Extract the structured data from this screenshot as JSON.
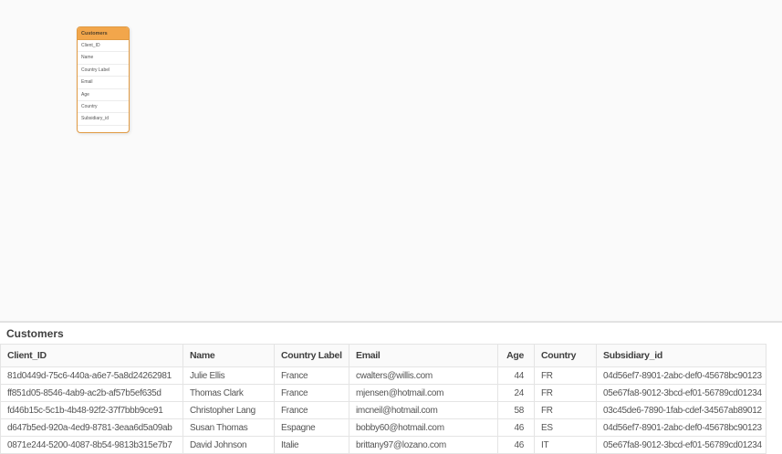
{
  "colors": {
    "card_header_orange": "#f2a64b",
    "card_border_orange": "#e09a43",
    "canvas_background": "#fafafa",
    "table_border_gray": "#e4e4e4"
  },
  "canvas": {
    "card": {
      "title": "Customers",
      "fields": [
        "Client_ID",
        "Name",
        "Country Label",
        "Email",
        "Age",
        "Country",
        "Subsidiary_id"
      ]
    }
  },
  "preview": {
    "title": "Customers",
    "table": {
      "columns": [
        "Client_ID",
        "Name",
        "Country Label",
        "Email",
        "Age",
        "Country",
        "Subsidiary_id"
      ],
      "rows": [
        [
          "81d0449d-75c6-440a-a6e7-5a8d24262981",
          "Julie Ellis",
          "France",
          "cwalters@willis.com",
          "44",
          "FR",
          "04d56ef7-8901-2abc-def0-45678bc90123"
        ],
        [
          "ff851d05-8546-4ab9-ac2b-af57b5ef635d",
          "Thomas Clark",
          "France",
          "mjensen@hotmail.com",
          "24",
          "FR",
          "05e67fa8-9012-3bcd-ef01-56789cd01234"
        ],
        [
          "fd46b15c-5c1b-4b48-92f2-37f7bbb9ce91",
          "Christopher Lang",
          "France",
          "imcneil@hotmail.com",
          "58",
          "FR",
          "03c45de6-7890-1fab-cdef-34567ab89012"
        ],
        [
          "d647b5ed-920a-4ed9-8781-3eaa6d5a09ab",
          "Susan Thomas",
          "Espagne",
          "bobby60@hotmail.com",
          "46",
          "ES",
          "04d56ef7-8901-2abc-def0-45678bc90123"
        ],
        [
          "0871e244-5200-4087-8b54-9813b315e7b7",
          "David Johnson",
          "Italie",
          "brittany97@lozano.com",
          "46",
          "IT",
          "05e67fa8-9012-3bcd-ef01-56789cd01234"
        ]
      ]
    }
  }
}
